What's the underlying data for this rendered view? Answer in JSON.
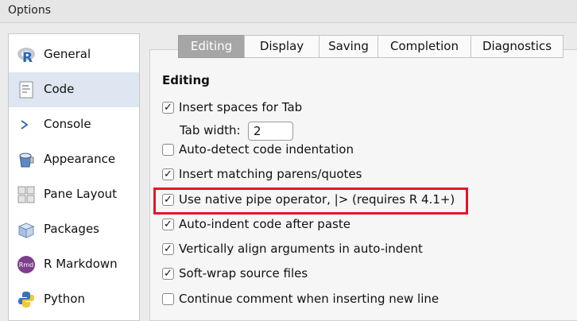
{
  "window": {
    "title": "Options"
  },
  "sidebar": {
    "items": [
      {
        "label": "General",
        "icon": "r-logo-icon",
        "active": false
      },
      {
        "label": "Code",
        "icon": "code-document-icon",
        "active": true
      },
      {
        "label": "Console",
        "icon": "console-prompt-icon",
        "active": false
      },
      {
        "label": "Appearance",
        "icon": "paint-bucket-icon",
        "active": false
      },
      {
        "label": "Pane Layout",
        "icon": "pane-layout-icon",
        "active": false
      },
      {
        "label": "Packages",
        "icon": "package-box-icon",
        "active": false
      },
      {
        "label": "R Markdown",
        "icon": "rmd-icon",
        "active": false
      },
      {
        "label": "Python",
        "icon": "python-icon",
        "active": false
      }
    ]
  },
  "tabs": [
    {
      "label": "Editing",
      "active": true
    },
    {
      "label": "Display",
      "active": false
    },
    {
      "label": "Saving",
      "active": false
    },
    {
      "label": "Completion",
      "active": false
    },
    {
      "label": "Diagnostics",
      "active": false
    }
  ],
  "editing": {
    "section_title": "Editing",
    "tab_width_label": "Tab width:",
    "tab_width_value": "2",
    "options": [
      {
        "label": "Insert spaces for Tab",
        "checked": true
      },
      {
        "label": "Auto-detect code indentation",
        "checked": false
      },
      {
        "label": "Insert matching parens/quotes",
        "checked": true
      },
      {
        "label": "Use native pipe operator, |> (requires R 4.1+)",
        "checked": true,
        "highlighted": true
      },
      {
        "label": "Auto-indent code after paste",
        "checked": true
      },
      {
        "label": "Vertically align arguments in auto-indent",
        "checked": true
      },
      {
        "label": "Soft-wrap source files",
        "checked": true
      },
      {
        "label": "Continue comment when inserting new line",
        "checked": false
      }
    ]
  },
  "colors": {
    "highlight": "#e3152b",
    "active_tab": "#a6a6a6",
    "active_sidebar": "#dde6f1"
  }
}
